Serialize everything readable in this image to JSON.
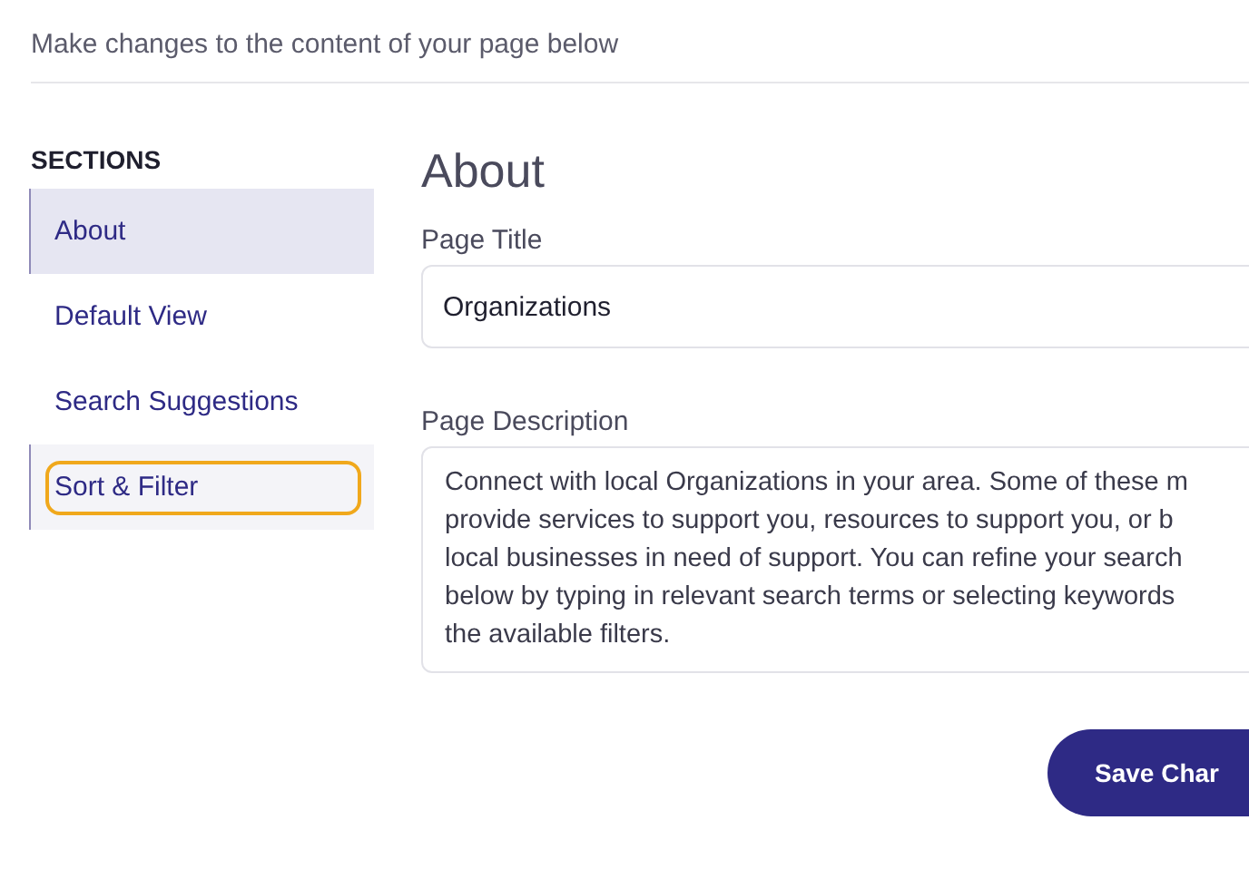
{
  "subtitle": "Make changes to the content of your page below",
  "sidebar": {
    "heading": "SECTIONS",
    "items": [
      {
        "label": "About",
        "selected": true,
        "focused": false
      },
      {
        "label": "Default View",
        "selected": false,
        "focused": false
      },
      {
        "label": "Search Suggestions",
        "selected": false,
        "focused": false
      },
      {
        "label": "Sort & Filter",
        "selected": false,
        "focused": true
      }
    ]
  },
  "main": {
    "heading": "About",
    "page_title": {
      "label": "Page Title",
      "value": "Organizations"
    },
    "page_description": {
      "label": "Page Description",
      "lines": [
        "Connect with local Organizations in your area. Some of these m",
        "provide services to support you, resources to support you, or b",
        "local businesses in need of support. You can refine your search",
        "below by typing in relevant search terms or selecting keywords",
        "the available filters."
      ]
    },
    "save_button": "Save Char"
  }
}
